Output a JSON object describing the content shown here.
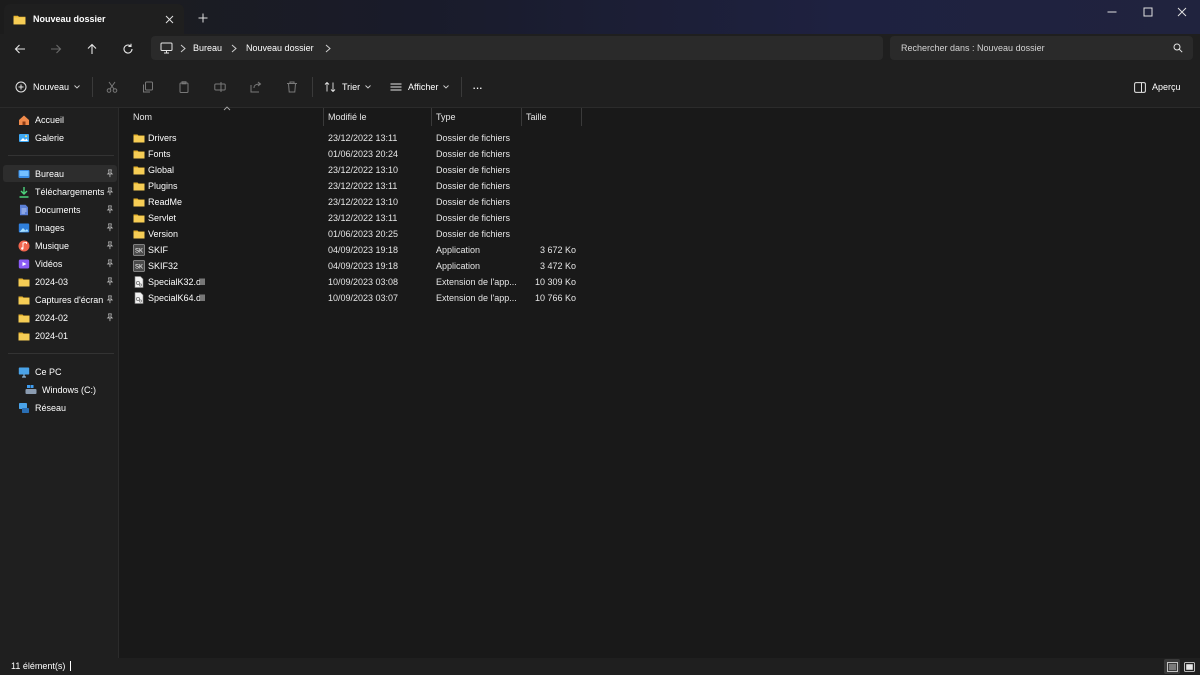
{
  "window": {
    "tab_title": "Nouveau dossier",
    "tab_icon": "folder-icon",
    "new_tab_symbol": "+"
  },
  "address": {
    "breadcrumb": [
      "Bureau",
      "Nouveau dossier"
    ],
    "search_placeholder": "Rechercher dans : Nouveau dossier"
  },
  "commands": {
    "new_label": "Nouveau",
    "sort_label": "Trier",
    "view_label": "Afficher",
    "more_label": "···",
    "preview_label": "Aperçu"
  },
  "sidebar": {
    "items": [
      {
        "label": "Accueil",
        "icon": "home-icon",
        "pinned": false
      },
      {
        "label": "Galerie",
        "icon": "gallery-icon",
        "pinned": false
      },
      {
        "label": "Bureau",
        "icon": "desktop-icon",
        "pinned": true,
        "selected": true
      },
      {
        "label": "Téléchargements",
        "icon": "download-icon",
        "pinned": true
      },
      {
        "label": "Documents",
        "icon": "documents-icon",
        "pinned": true
      },
      {
        "label": "Images",
        "icon": "pictures-icon",
        "pinned": true
      },
      {
        "label": "Musique",
        "icon": "music-icon",
        "pinned": true
      },
      {
        "label": "Vidéos",
        "icon": "videos-icon",
        "pinned": true
      },
      {
        "label": "2024-03",
        "icon": "folder-icon",
        "pinned": true
      },
      {
        "label": "Captures d'écran",
        "icon": "folder-icon",
        "pinned": true
      },
      {
        "label": "2024-02",
        "icon": "folder-icon",
        "pinned": true
      },
      {
        "label": "2024-01",
        "icon": "folder-icon",
        "pinned": false
      }
    ],
    "this_pc": "Ce PC",
    "drive": "Windows (C:)",
    "network": "Réseau"
  },
  "columns": {
    "name": "Nom",
    "modified": "Modifié le",
    "type": "Type",
    "size": "Taille"
  },
  "files": [
    {
      "name": "Drivers",
      "modified": "23/12/2022 13:11",
      "type": "Dossier de fichiers",
      "size": "",
      "icon": "folder-icon"
    },
    {
      "name": "Fonts",
      "modified": "01/06/2023 20:24",
      "type": "Dossier de fichiers",
      "size": "",
      "icon": "folder-icon"
    },
    {
      "name": "Global",
      "modified": "23/12/2022 13:10",
      "type": "Dossier de fichiers",
      "size": "",
      "icon": "folder-icon"
    },
    {
      "name": "Plugins",
      "modified": "23/12/2022 13:11",
      "type": "Dossier de fichiers",
      "size": "",
      "icon": "folder-icon"
    },
    {
      "name": "ReadMe",
      "modified": "23/12/2022 13:10",
      "type": "Dossier de fichiers",
      "size": "",
      "icon": "folder-icon"
    },
    {
      "name": "Servlet",
      "modified": "23/12/2022 13:11",
      "type": "Dossier de fichiers",
      "size": "",
      "icon": "folder-icon"
    },
    {
      "name": "Version",
      "modified": "01/06/2023 20:25",
      "type": "Dossier de fichiers",
      "size": "",
      "icon": "folder-icon"
    },
    {
      "name": "SKIF",
      "modified": "04/09/2023 19:18",
      "type": "Application",
      "size": "3 672 Ko",
      "icon": "app-icon"
    },
    {
      "name": "SKIF32",
      "modified": "04/09/2023 19:18",
      "type": "Application",
      "size": "3 472 Ko",
      "icon": "app-icon"
    },
    {
      "name": "SpecialK32.dll",
      "modified": "10/09/2023 03:08",
      "type": "Extension de l'app...",
      "size": "10 309 Ko",
      "icon": "dll-icon"
    },
    {
      "name": "SpecialK64.dll",
      "modified": "10/09/2023 03:07",
      "type": "Extension de l'app...",
      "size": "10 766 Ko",
      "icon": "dll-icon"
    }
  ],
  "status": {
    "count_text": "11 élément(s)"
  },
  "colors": {
    "folder": "#f4c744",
    "accent": "#4cc2ff"
  }
}
